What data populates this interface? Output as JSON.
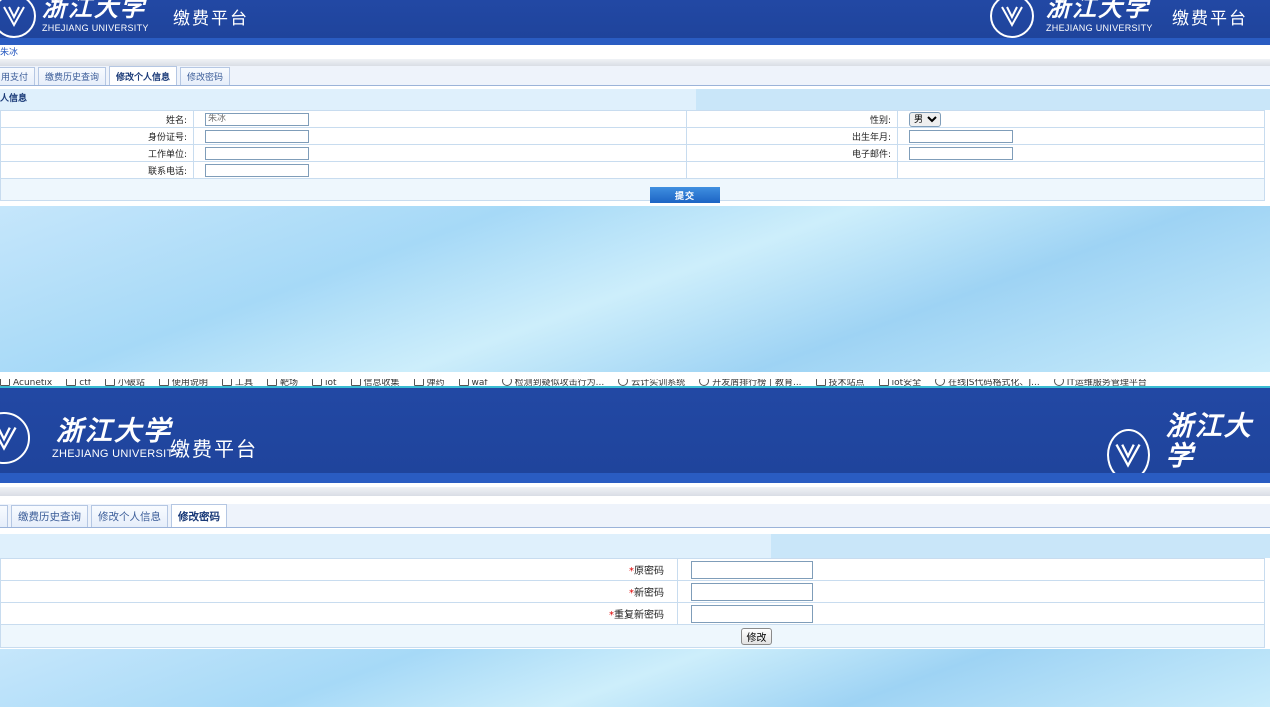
{
  "top": {
    "header": {
      "school_cn": "浙江大学",
      "school_en": "ZHEJIANG UNIVERSITY",
      "platform": "缴费平台"
    },
    "user_name": "朱冰",
    "tabs": [
      {
        "label": "用支付",
        "active": false
      },
      {
        "label": "缴费历史查询",
        "active": false
      },
      {
        "label": "修改个人信息",
        "active": true
      },
      {
        "label": "修改密码",
        "active": false
      }
    ],
    "section_title": "人信息",
    "form": {
      "name_label": "姓名:",
      "name_placeholder": "朱冰",
      "gender_label": "性别:",
      "gender_value": "男",
      "id_label": "身份证号:",
      "birth_label": "出生年月:",
      "work_label": "工作单位:",
      "email_label": "电子邮件:",
      "phone_label": "联系电话:",
      "submit_label": "提交"
    }
  },
  "bookmarks": [
    {
      "label": "Acunetix",
      "icon": "app-icon"
    },
    {
      "label": "ctf",
      "icon": "folder-icon"
    },
    {
      "label": "小破站",
      "icon": "folder-icon"
    },
    {
      "label": "使用说明",
      "icon": "folder-icon"
    },
    {
      "label": "工具",
      "icon": "folder-icon"
    },
    {
      "label": "靶场",
      "icon": "folder-icon"
    },
    {
      "label": "iot",
      "icon": "folder-icon"
    },
    {
      "label": "信息收集",
      "icon": "folder-icon"
    },
    {
      "label": "弹药",
      "icon": "folder-icon"
    },
    {
      "label": "waf",
      "icon": "folder-icon"
    },
    {
      "label": "检测到疑似攻击行为...",
      "icon": "globe-icon"
    },
    {
      "label": "云计实训系统",
      "icon": "globe-icon"
    },
    {
      "label": "开发屑排行榜 | 教育...",
      "icon": "globe-icon"
    },
    {
      "label": "技术站点",
      "icon": "folder-icon"
    },
    {
      "label": "iot安全",
      "icon": "folder-icon"
    },
    {
      "label": "在线JS代码格式化、J...",
      "icon": "globe-icon"
    },
    {
      "label": "IT运维服务管理平台",
      "icon": "globe-icon"
    }
  ],
  "bottom": {
    "header": {
      "school_cn": "浙江大学",
      "school_en": "ZHEJIANG UNIVERSITY",
      "platform": "缴费平台"
    },
    "tabs": [
      {
        "label": "缴费历史查询",
        "active": false
      },
      {
        "label": "修改个人信息",
        "active": false
      },
      {
        "label": "修改密码",
        "active": true
      }
    ],
    "form": {
      "required_mark": "*",
      "old_password_label": "原密码",
      "new_password_label": "新密码",
      "repeat_password_label": "重复新密码",
      "submit_label": "修改"
    }
  }
}
